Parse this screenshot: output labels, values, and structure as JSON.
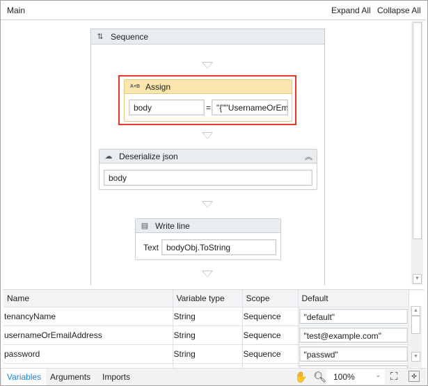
{
  "header": {
    "title": "Main",
    "expand_all": "Expand All",
    "collapse_all": "Collapse All"
  },
  "sequence": {
    "title": "Sequence"
  },
  "assign": {
    "title": "Assign",
    "icon_text": "A+B",
    "to": "body",
    "equals": "=",
    "value": "\"{\"\"UsernameOrEm"
  },
  "deserialize": {
    "title": "Deserialize json",
    "input": "body"
  },
  "writeline": {
    "title": "Write line",
    "label": "Text",
    "value": "bodyObj.ToString"
  },
  "variables": {
    "columns": [
      "Name",
      "Variable type",
      "Scope",
      "Default"
    ],
    "rows": [
      {
        "name": "tenancyName",
        "type": "String",
        "scope": "Sequence",
        "default": "\"default\""
      },
      {
        "name": "usernameOrEmailAddress",
        "type": "String",
        "scope": "Sequence",
        "default": "\"test@example.com\""
      },
      {
        "name": "password",
        "type": "String",
        "scope": "Sequence",
        "default": "\"passwd\""
      }
    ]
  },
  "bottom": {
    "tabs": [
      "Variables",
      "Arguments",
      "Imports"
    ],
    "zoom": "100%"
  },
  "colors": {
    "selection": "#e8352a",
    "assign_header": "#fbe7ad",
    "link": "#1e7fd8"
  }
}
